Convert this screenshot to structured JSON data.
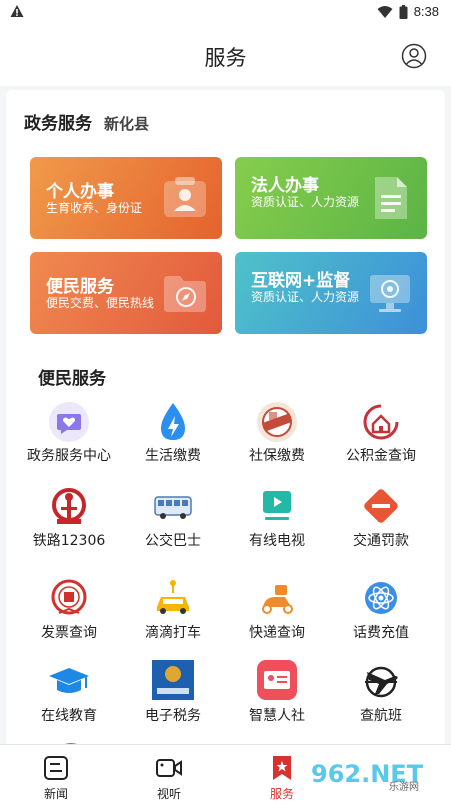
{
  "status_bar": {
    "time": "8:38"
  },
  "header": {
    "title": "服务"
  },
  "gov_section": {
    "title": "政务服务",
    "county": "新化县"
  },
  "tiles": [
    {
      "name": "个人办事",
      "desc": "生育收养、身份证"
    },
    {
      "name": "法人办事",
      "desc": "资质认证、人力资源"
    },
    {
      "name": "便民服务",
      "desc": "便民交费、便民热线"
    },
    {
      "name": "互联网+监督",
      "desc": "资质认证、人力资源"
    }
  ],
  "convenience": {
    "title": "便民服务",
    "items": [
      {
        "label": "政务服务中心",
        "icon": "heart-chat-icon"
      },
      {
        "label": "生活缴费",
        "icon": "water-bolt-icon"
      },
      {
        "label": "社保缴费",
        "icon": "social-security-badge-icon"
      },
      {
        "label": "公积金查询",
        "icon": "house-icon"
      },
      {
        "label": "铁路12306",
        "icon": "railway-icon"
      },
      {
        "label": "公交巴士",
        "icon": "bus-icon"
      },
      {
        "label": "有线电视",
        "icon": "tv-icon"
      },
      {
        "label": "交通罚款",
        "icon": "traffic-fine-icon"
      },
      {
        "label": "发票查询",
        "icon": "tax-emblem-icon"
      },
      {
        "label": "滴滴打车",
        "icon": "taxi-icon"
      },
      {
        "label": "快递查询",
        "icon": "scooter-icon"
      },
      {
        "label": "话费充值",
        "icon": "atom-icon"
      },
      {
        "label": "在线教育",
        "icon": "graduation-cap-icon"
      },
      {
        "label": "电子税务",
        "icon": "e-tax-icon"
      },
      {
        "label": "智慧人社",
        "icon": "id-card-icon"
      },
      {
        "label": "查航班",
        "icon": "airplane-icon"
      }
    ]
  },
  "bottom_nav": [
    {
      "label": "新闻",
      "icon": "news-icon"
    },
    {
      "label": "视听",
      "icon": "video-icon"
    },
    {
      "label": "服务",
      "icon": "service-bookmark-icon"
    }
  ],
  "watermark": {
    "text": "962.NET",
    "sub": "乐游网"
  },
  "colors": {
    "accent": "#d9322e",
    "orange": "#e5622e",
    "green": "#5bb445",
    "teal": "#3d8fd9"
  }
}
